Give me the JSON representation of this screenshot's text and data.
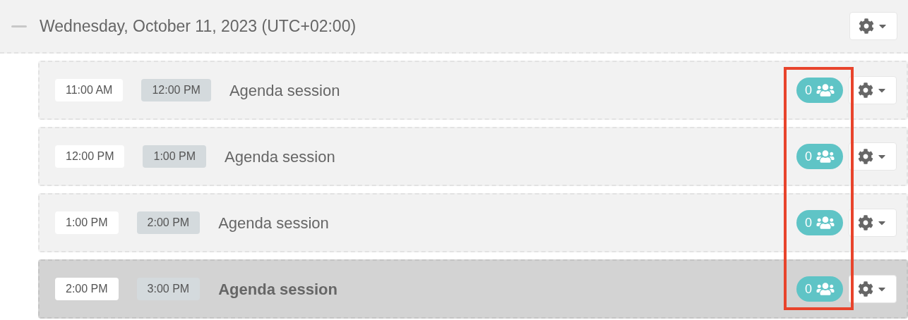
{
  "day": {
    "title": "Wednesday, October 11, 2023 (UTC+02:00)",
    "expanded": true
  },
  "sessions": [
    {
      "start": "11:00 AM",
      "end": "12:00 PM",
      "title": "Agenda session",
      "attendees": "0",
      "selected": false
    },
    {
      "start": "12:00 PM",
      "end": "1:00 PM",
      "title": "Agenda session",
      "attendees": "0",
      "selected": false
    },
    {
      "start": "1:00 PM",
      "end": "2:00 PM",
      "title": "Agenda session",
      "attendees": "0",
      "selected": false
    },
    {
      "start": "2:00 PM",
      "end": "3:00 PM",
      "title": "Agenda session",
      "attendees": "0",
      "selected": true
    }
  ]
}
